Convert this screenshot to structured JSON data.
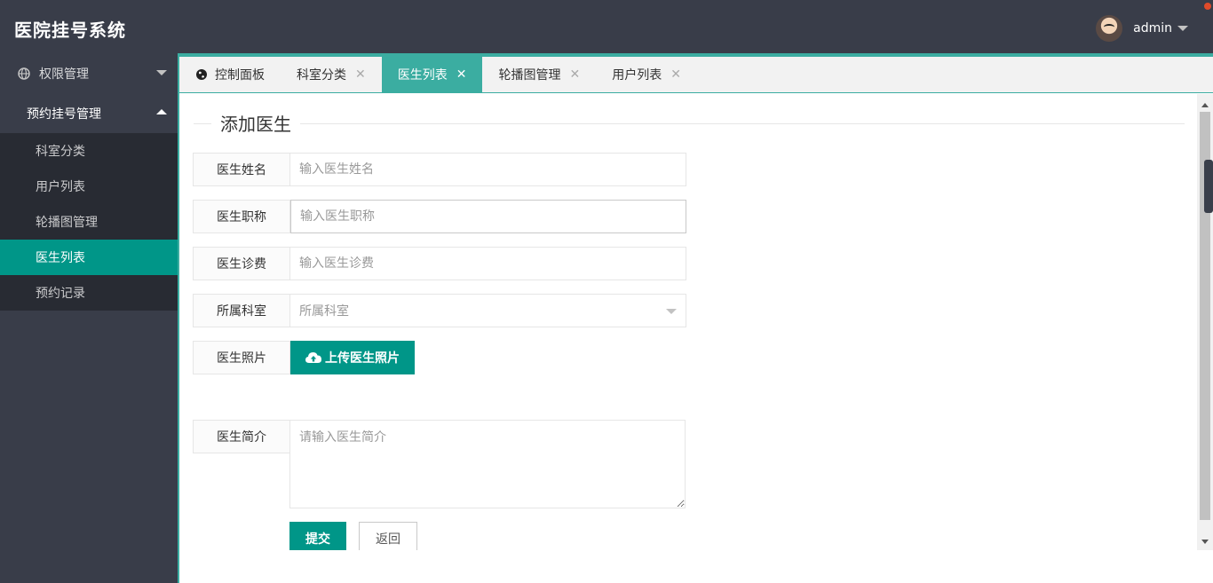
{
  "app": {
    "title": "医院挂号系统"
  },
  "header": {
    "user_name": "admin"
  },
  "sidebar": {
    "groups": [
      {
        "label": "权限管理",
        "icon": "globe-icon",
        "open": false
      },
      {
        "label": "预约挂号管理",
        "open": true
      }
    ],
    "items": [
      {
        "label": "科室分类"
      },
      {
        "label": "用户列表"
      },
      {
        "label": "轮播图管理"
      },
      {
        "label": "医生列表",
        "active": true
      },
      {
        "label": "预约记录"
      }
    ]
  },
  "tabs": [
    {
      "label": "控制面板",
      "icon": "globe-icon"
    },
    {
      "label": "科室分类"
    },
    {
      "label": "医生列表",
      "active": true
    },
    {
      "label": "轮播图管理"
    },
    {
      "label": "用户列表"
    }
  ],
  "form": {
    "legend": "添加医生",
    "name": {
      "label": "医生姓名",
      "placeholder": "输入医生姓名"
    },
    "title": {
      "label": "医生职称",
      "placeholder": "输入医生职称"
    },
    "fee": {
      "label": "医生诊费",
      "placeholder": "输入医生诊费"
    },
    "department": {
      "label": "所属科室",
      "placeholder": "所属科室"
    },
    "photo": {
      "label": "医生照片",
      "button": "上传医生照片"
    },
    "intro": {
      "label": "医生简介",
      "placeholder": "请输入医生简介"
    },
    "submit": "提交",
    "back": "返回"
  },
  "colors": {
    "header_bg": "#393d49",
    "accent": "#009688",
    "tab_active": "#3bada1"
  }
}
